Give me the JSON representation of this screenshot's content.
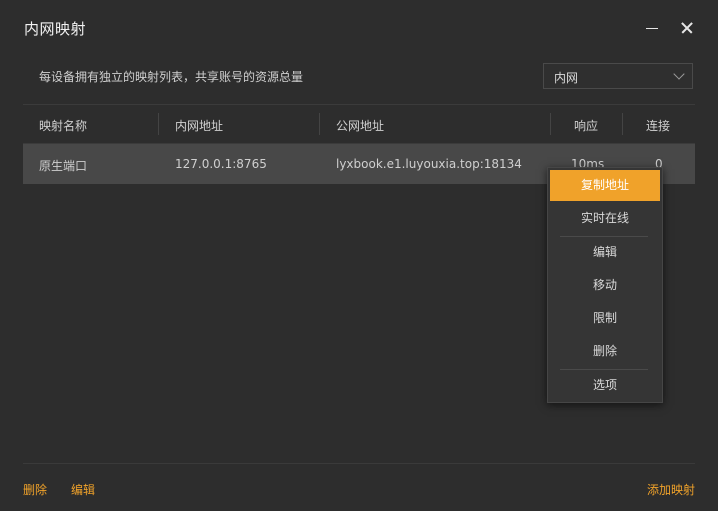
{
  "window": {
    "title": "内网映射"
  },
  "header": {
    "subtitle": "每设备拥有独立的映射列表，共享账号的资源总量",
    "network_select": {
      "value": "内网"
    }
  },
  "table": {
    "columns": [
      "映射名称",
      "内网地址",
      "公网地址",
      "响应",
      "连接"
    ],
    "rows": [
      {
        "name": "原生端口",
        "local": "127.0.0.1:8765",
        "public": "lyxbook.e1.luyouxia.top:18134",
        "latency": "10ms",
        "connections": "0"
      }
    ]
  },
  "context_menu": {
    "items": [
      {
        "label": "复制地址",
        "active": true
      },
      {
        "label": "实时在线"
      },
      {
        "label": "编辑"
      },
      {
        "label": "移动"
      },
      {
        "label": "限制"
      },
      {
        "label": "删除"
      },
      {
        "label": "选项"
      }
    ]
  },
  "footer": {
    "delete_label": "删除",
    "edit_label": "编辑",
    "add_label": "添加映射"
  },
  "colors": {
    "accent": "#f0a22a",
    "background": "#2d2d2d",
    "selected_row": "#484848"
  }
}
